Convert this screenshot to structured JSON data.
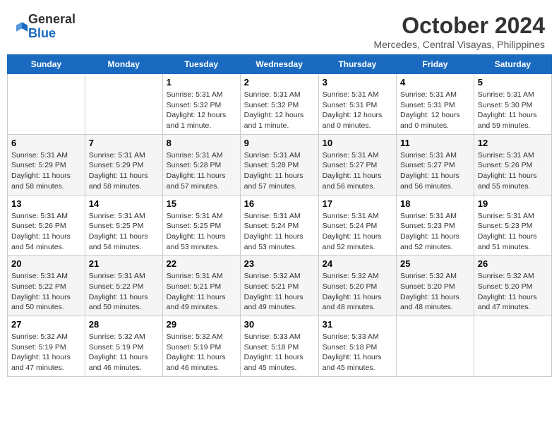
{
  "logo": {
    "general": "General",
    "blue": "Blue"
  },
  "title": "October 2024",
  "location": "Mercedes, Central Visayas, Philippines",
  "headers": [
    "Sunday",
    "Monday",
    "Tuesday",
    "Wednesday",
    "Thursday",
    "Friday",
    "Saturday"
  ],
  "weeks": [
    [
      {
        "day": "",
        "sunrise": "",
        "sunset": "",
        "daylight": ""
      },
      {
        "day": "",
        "sunrise": "",
        "sunset": "",
        "daylight": ""
      },
      {
        "day": "1",
        "sunrise": "Sunrise: 5:31 AM",
        "sunset": "Sunset: 5:32 PM",
        "daylight": "Daylight: 12 hours and 1 minute."
      },
      {
        "day": "2",
        "sunrise": "Sunrise: 5:31 AM",
        "sunset": "Sunset: 5:32 PM",
        "daylight": "Daylight: 12 hours and 1 minute."
      },
      {
        "day": "3",
        "sunrise": "Sunrise: 5:31 AM",
        "sunset": "Sunset: 5:31 PM",
        "daylight": "Daylight: 12 hours and 0 minutes."
      },
      {
        "day": "4",
        "sunrise": "Sunrise: 5:31 AM",
        "sunset": "Sunset: 5:31 PM",
        "daylight": "Daylight: 12 hours and 0 minutes."
      },
      {
        "day": "5",
        "sunrise": "Sunrise: 5:31 AM",
        "sunset": "Sunset: 5:30 PM",
        "daylight": "Daylight: 11 hours and 59 minutes."
      }
    ],
    [
      {
        "day": "6",
        "sunrise": "Sunrise: 5:31 AM",
        "sunset": "Sunset: 5:29 PM",
        "daylight": "Daylight: 11 hours and 58 minutes."
      },
      {
        "day": "7",
        "sunrise": "Sunrise: 5:31 AM",
        "sunset": "Sunset: 5:29 PM",
        "daylight": "Daylight: 11 hours and 58 minutes."
      },
      {
        "day": "8",
        "sunrise": "Sunrise: 5:31 AM",
        "sunset": "Sunset: 5:28 PM",
        "daylight": "Daylight: 11 hours and 57 minutes."
      },
      {
        "day": "9",
        "sunrise": "Sunrise: 5:31 AM",
        "sunset": "Sunset: 5:28 PM",
        "daylight": "Daylight: 11 hours and 57 minutes."
      },
      {
        "day": "10",
        "sunrise": "Sunrise: 5:31 AM",
        "sunset": "Sunset: 5:27 PM",
        "daylight": "Daylight: 11 hours and 56 minutes."
      },
      {
        "day": "11",
        "sunrise": "Sunrise: 5:31 AM",
        "sunset": "Sunset: 5:27 PM",
        "daylight": "Daylight: 11 hours and 56 minutes."
      },
      {
        "day": "12",
        "sunrise": "Sunrise: 5:31 AM",
        "sunset": "Sunset: 5:26 PM",
        "daylight": "Daylight: 11 hours and 55 minutes."
      }
    ],
    [
      {
        "day": "13",
        "sunrise": "Sunrise: 5:31 AM",
        "sunset": "Sunset: 5:26 PM",
        "daylight": "Daylight: 11 hours and 54 minutes."
      },
      {
        "day": "14",
        "sunrise": "Sunrise: 5:31 AM",
        "sunset": "Sunset: 5:25 PM",
        "daylight": "Daylight: 11 hours and 54 minutes."
      },
      {
        "day": "15",
        "sunrise": "Sunrise: 5:31 AM",
        "sunset": "Sunset: 5:25 PM",
        "daylight": "Daylight: 11 hours and 53 minutes."
      },
      {
        "day": "16",
        "sunrise": "Sunrise: 5:31 AM",
        "sunset": "Sunset: 5:24 PM",
        "daylight": "Daylight: 11 hours and 53 minutes."
      },
      {
        "day": "17",
        "sunrise": "Sunrise: 5:31 AM",
        "sunset": "Sunset: 5:24 PM",
        "daylight": "Daylight: 11 hours and 52 minutes."
      },
      {
        "day": "18",
        "sunrise": "Sunrise: 5:31 AM",
        "sunset": "Sunset: 5:23 PM",
        "daylight": "Daylight: 11 hours and 52 minutes."
      },
      {
        "day": "19",
        "sunrise": "Sunrise: 5:31 AM",
        "sunset": "Sunset: 5:23 PM",
        "daylight": "Daylight: 11 hours and 51 minutes."
      }
    ],
    [
      {
        "day": "20",
        "sunrise": "Sunrise: 5:31 AM",
        "sunset": "Sunset: 5:22 PM",
        "daylight": "Daylight: 11 hours and 50 minutes."
      },
      {
        "day": "21",
        "sunrise": "Sunrise: 5:31 AM",
        "sunset": "Sunset: 5:22 PM",
        "daylight": "Daylight: 11 hours and 50 minutes."
      },
      {
        "day": "22",
        "sunrise": "Sunrise: 5:31 AM",
        "sunset": "Sunset: 5:21 PM",
        "daylight": "Daylight: 11 hours and 49 minutes."
      },
      {
        "day": "23",
        "sunrise": "Sunrise: 5:32 AM",
        "sunset": "Sunset: 5:21 PM",
        "daylight": "Daylight: 11 hours and 49 minutes."
      },
      {
        "day": "24",
        "sunrise": "Sunrise: 5:32 AM",
        "sunset": "Sunset: 5:20 PM",
        "daylight": "Daylight: 11 hours and 48 minutes."
      },
      {
        "day": "25",
        "sunrise": "Sunrise: 5:32 AM",
        "sunset": "Sunset: 5:20 PM",
        "daylight": "Daylight: 11 hours and 48 minutes."
      },
      {
        "day": "26",
        "sunrise": "Sunrise: 5:32 AM",
        "sunset": "Sunset: 5:20 PM",
        "daylight": "Daylight: 11 hours and 47 minutes."
      }
    ],
    [
      {
        "day": "27",
        "sunrise": "Sunrise: 5:32 AM",
        "sunset": "Sunset: 5:19 PM",
        "daylight": "Daylight: 11 hours and 47 minutes."
      },
      {
        "day": "28",
        "sunrise": "Sunrise: 5:32 AM",
        "sunset": "Sunset: 5:19 PM",
        "daylight": "Daylight: 11 hours and 46 minutes."
      },
      {
        "day": "29",
        "sunrise": "Sunrise: 5:32 AM",
        "sunset": "Sunset: 5:19 PM",
        "daylight": "Daylight: 11 hours and 46 minutes."
      },
      {
        "day": "30",
        "sunrise": "Sunrise: 5:33 AM",
        "sunset": "Sunset: 5:18 PM",
        "daylight": "Daylight: 11 hours and 45 minutes."
      },
      {
        "day": "31",
        "sunrise": "Sunrise: 5:33 AM",
        "sunset": "Sunset: 5:18 PM",
        "daylight": "Daylight: 11 hours and 45 minutes."
      },
      {
        "day": "",
        "sunrise": "",
        "sunset": "",
        "daylight": ""
      },
      {
        "day": "",
        "sunrise": "",
        "sunset": "",
        "daylight": ""
      }
    ]
  ]
}
